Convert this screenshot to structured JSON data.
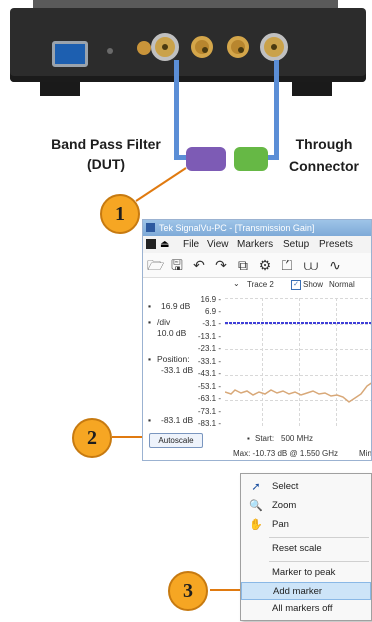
{
  "hardware": {
    "label_filter": "Band Pass Filter",
    "label_dut": "(DUT)",
    "label_through": "Through",
    "label_connector": "Connector"
  },
  "callouts": [
    "1",
    "2",
    "3"
  ],
  "colors": {
    "callout": "#f6a623",
    "cable": "#5b8ed6",
    "trace_flat": "#3f3fd8",
    "trace_noise": "#d8a878"
  },
  "app": {
    "title": "Tek SignalVu-PC - [Transmission Gain]",
    "menu": [
      "File",
      "View",
      "Markers",
      "Setup",
      "Presets"
    ],
    "toolbar_icons": [
      "open-icon",
      "save-icon",
      "undo-icon",
      "redo-icon",
      "window-icon",
      "gear-icon",
      "marker-icon",
      "trace-icon",
      "waveform-icon"
    ],
    "trace_selector": "Trace 2",
    "show_label": "Show",
    "detect": "Normal",
    "ref_level": "16.9 dB",
    "div_label": "/div",
    "div_value": "10.0 dB",
    "position_label": "Position:",
    "position_value": "-33.1 dB",
    "bottom_level": "-83.1 dB",
    "autoscale": "Autoscale",
    "y_ticks": [
      "16.9 -",
      "6.9 -",
      "-3.1 -",
      "-13.1 -",
      "-23.1 -",
      "-33.1 -",
      "-43.1 -",
      "-53.1 -",
      "-63.1 -",
      "-73.1 -",
      "-83.1 -"
    ],
    "start_label": "Start:",
    "start_value": "500 MHz",
    "max_readout": "Max: -10.73 dB @ 1.550 GHz",
    "min_partial": "Min"
  },
  "context_menu": {
    "items": [
      {
        "label": "Select",
        "icon": "pointer-icon"
      },
      {
        "label": "Zoom",
        "icon": "zoom-icon"
      },
      {
        "label": "Pan",
        "icon": "hand-icon"
      },
      {
        "label": "Reset scale",
        "icon": ""
      },
      {
        "label": "Marker to peak",
        "icon": ""
      },
      {
        "label": "Add marker",
        "icon": "",
        "highlighted": true
      },
      {
        "label": "All markers off",
        "icon": ""
      }
    ]
  }
}
